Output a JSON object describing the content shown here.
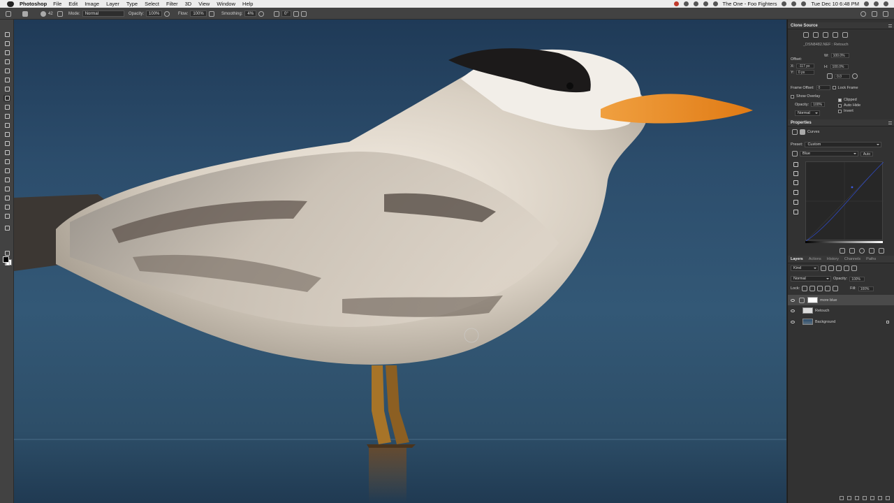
{
  "menubar": {
    "app": "Photoshop",
    "items": [
      "File",
      "Edit",
      "Image",
      "Layer",
      "Type",
      "Select",
      "Filter",
      "3D",
      "View",
      "Window",
      "Help"
    ],
    "now_playing": "The One - Foo Fighters",
    "datetime": "Tue Dec 10  6:48 PM"
  },
  "options": {
    "brush_size": "42",
    "mode_label": "Mode:",
    "mode_value": "Normal",
    "opacity_label": "Opacity:",
    "opacity_value": "100%",
    "flow_label": "Flow:",
    "flow_value": "100%",
    "smoothing_label": "Smoothing:",
    "smoothing_value": "4%",
    "angle_value": "0°"
  },
  "clone_source": {
    "title": "Clone Source",
    "filename": "_DSN8482.NEF : Retouch",
    "offset_label": "Offset:",
    "x_label": "X:",
    "x_value": "-117 px",
    "y_label": "Y:",
    "y_value": "0 px",
    "w_label": "W:",
    "w_value": "100.0%",
    "h_label": "H:",
    "h_value": "100.0%",
    "angle_value": "0.0",
    "frame_offset_label": "Frame Offset:",
    "frame_offset_value": "0",
    "lock_frame": "Lock Frame",
    "show_overlay": "Show Overlay",
    "opacity_label": "Opacity:",
    "opacity_value": "100%",
    "blend_value": "Normal",
    "clipped": "Clipped",
    "auto_hide": "Auto Hide",
    "invert": "Invert"
  },
  "properties": {
    "title": "Properties",
    "adjustment": "Curves",
    "preset_label": "Preset:",
    "preset_value": "Custom",
    "channel_value": "Blue",
    "auto_label": "Auto"
  },
  "layers_panel": {
    "tabs": [
      "Layers",
      "Actions",
      "History",
      "Channels",
      "Paths"
    ],
    "filter_value": "Kind",
    "blend_mode": "Normal",
    "opacity_label": "Opacity:",
    "opacity_value": "100%",
    "lock_label": "Lock:",
    "fill_label": "Fill:",
    "fill_value": "100%",
    "layers": [
      {
        "name": "more blue"
      },
      {
        "name": "Retouch"
      },
      {
        "name": "Background"
      }
    ]
  },
  "colors": {
    "sky_top": "#1f3a57",
    "sky_mid": "#335876",
    "beak": "#e8861e",
    "panel_bg": "#323232"
  }
}
